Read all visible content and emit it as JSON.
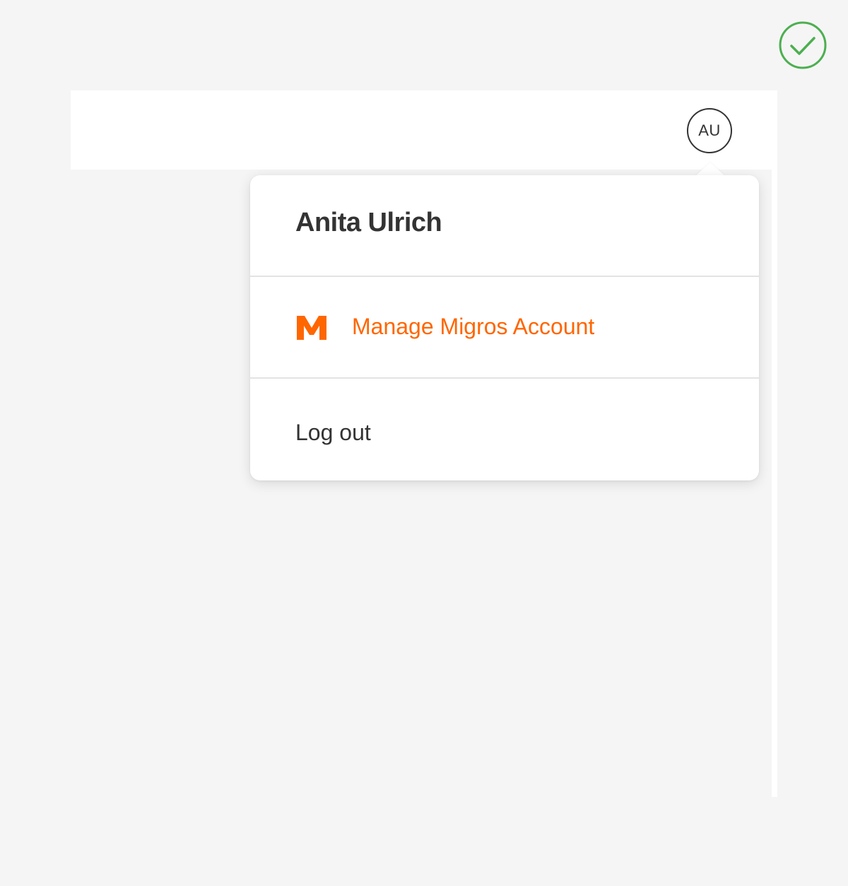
{
  "header": {
    "avatar_initials": "AU"
  },
  "account_menu": {
    "user_name": "Anita Ulrich",
    "manage_account_label": "Manage Migros Account",
    "manage_account_icon": "migros-m-logo",
    "logout_label": "Log out"
  },
  "status": {
    "icon": "check-circle-icon",
    "color": "#4caf50"
  },
  "colors": {
    "brand_orange": "#ff6600",
    "text_dark": "#333333",
    "background": "#f5f5f5"
  }
}
